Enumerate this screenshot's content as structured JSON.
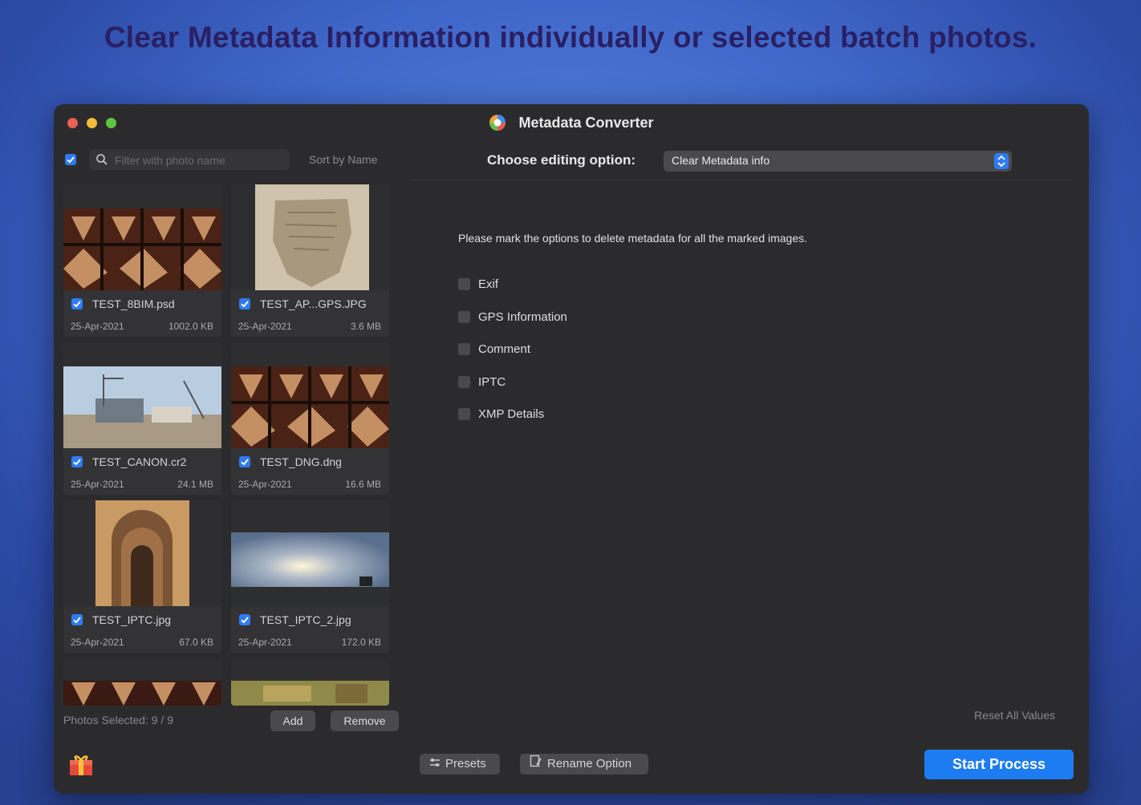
{
  "headline": "Clear Metadata Information individually or selected batch photos.",
  "window": {
    "title": "Metadata Converter"
  },
  "toolbar": {
    "search_placeholder": "Filter with photo name",
    "sort_label": "Sort by Name",
    "choose_label": "Choose editing option:",
    "editing_option": "Clear Metadata info"
  },
  "photos": [
    {
      "name": "TEST_8BIM.psd",
      "date": "25-Apr-2021",
      "size": "1002.0 KB",
      "checked": true
    },
    {
      "name": "TEST_AP...GPS.JPG",
      "date": "25-Apr-2021",
      "size": "3.6 MB",
      "checked": true
    },
    {
      "name": "TEST_CANON.cr2",
      "date": "25-Apr-2021",
      "size": "24.1 MB",
      "checked": true
    },
    {
      "name": "TEST_DNG.dng",
      "date": "25-Apr-2021",
      "size": "16.6 MB",
      "checked": true
    },
    {
      "name": "TEST_IPTC.jpg",
      "date": "25-Apr-2021",
      "size": "67.0 KB",
      "checked": true
    },
    {
      "name": "TEST_IPTC_2.jpg",
      "date": "25-Apr-2021",
      "size": "172.0 KB",
      "checked": true
    }
  ],
  "footer_left": {
    "photos_selected": "Photos Selected: 9 / 9",
    "add_label": "Add",
    "remove_label": "Remove"
  },
  "main": {
    "instruction": "Please mark the options to delete metadata for all the marked images.",
    "options": [
      {
        "label": "Exif",
        "checked": false
      },
      {
        "label": "GPS Information",
        "checked": false
      },
      {
        "label": "Comment",
        "checked": false
      },
      {
        "label": "IPTC",
        "checked": false
      },
      {
        "label": "XMP Details",
        "checked": false
      }
    ],
    "reset_label": "Reset All Values"
  },
  "bottom_bar": {
    "presets_label": "Presets",
    "rename_label": "Rename Option",
    "start_label": "Start Process"
  },
  "colors": {
    "accent": "#1e7cf2",
    "window_bg": "#2b2b2d",
    "headline": "#2a1f63"
  }
}
